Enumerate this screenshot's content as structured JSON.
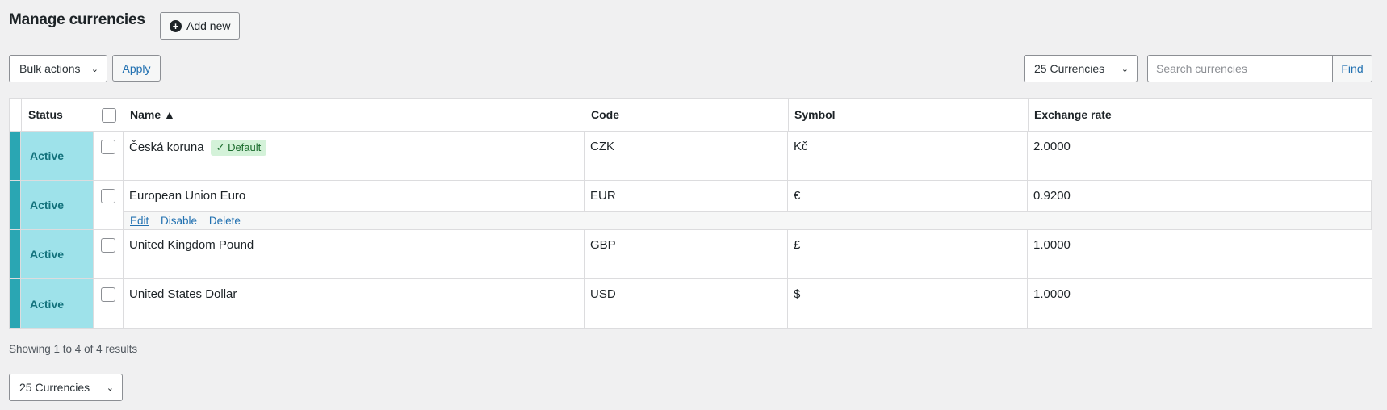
{
  "header": {
    "title": "Manage currencies",
    "add_new_label": "Add new"
  },
  "toolbar": {
    "bulk_actions": "Bulk actions",
    "apply_label": "Apply",
    "per_page": "25 Currencies",
    "search_placeholder": "Search currencies",
    "find_label": "Find"
  },
  "table": {
    "columns": {
      "status": "Status",
      "name": "Name ▲",
      "code": "Code",
      "symbol": "Symbol",
      "rate": "Exchange rate"
    },
    "rows": [
      {
        "status": "Active",
        "name": "Česká koruna",
        "badge": "✓ Default",
        "code": "CZK",
        "symbol": "Kč",
        "rate": "2.0000"
      },
      {
        "status": "Active",
        "name": "European Union Euro",
        "code": "EUR",
        "symbol": "€",
        "rate": "0.9200"
      },
      {
        "status": "Active",
        "name": "United Kingdom Pound",
        "code": "GBP",
        "symbol": "£",
        "rate": "1.0000"
      },
      {
        "status": "Active",
        "name": "United States Dollar",
        "code": "USD",
        "symbol": "$",
        "rate": "1.0000"
      }
    ],
    "row_actions": {
      "edit": "Edit",
      "disable": "Disable",
      "delete": "Delete"
    }
  },
  "footer": {
    "showing": "Showing 1 to 4 of 4 results",
    "per_page": "25 Currencies"
  },
  "colors": {
    "status_bar": "#2aa6b3",
    "status_bg": "#9ee2ea",
    "link": "#2271b1",
    "badge_bg": "#d4f2d9"
  },
  "icons": {
    "add": "plus-circle-icon",
    "dropdown": "chevron-down-icon"
  }
}
